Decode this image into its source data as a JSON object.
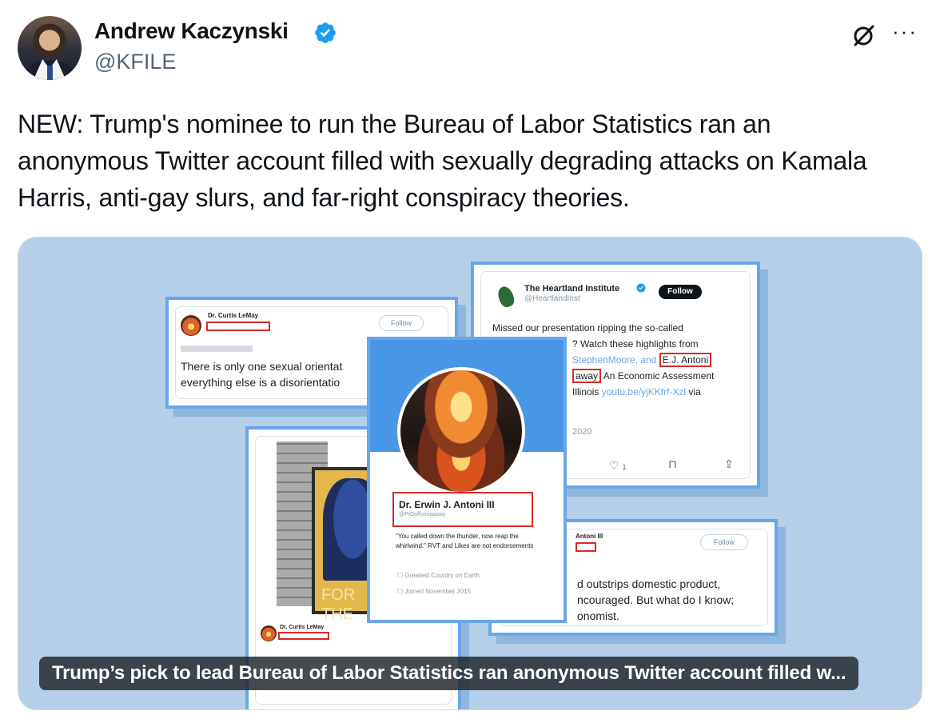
{
  "author": {
    "name": "Andrew Kaczynski",
    "handle": "@KFILE",
    "verified_color": "#1d9bf0"
  },
  "icons": {
    "grok": "grok-icon",
    "more": "more-icon",
    "verified": "verified-badge-icon"
  },
  "tweet": {
    "text": "NEW: Trump's nominee to run the Bureau of Labor Statistics ran an anonymous Twitter account filled with sexually degrading attacks on Kamala Harris, anti-gay slurs, and far-right conspiracy theories."
  },
  "media": {
    "caption": "Trump’s pick to lead Bureau of Labor Statistics ran anonymous Twitter account filled w...",
    "background": "#b5cfe8",
    "card_left": {
      "name": "Dr. Curtis LeMay",
      "follow": "Follow",
      "text_line1": "There is only one sexual orientat",
      "text_line2": "everything else is a disorientatio"
    },
    "card_heartland": {
      "name": "The Heartland Institute",
      "handle": "@HeartlandInst",
      "follow": "Follow",
      "line1": "Missed our presentation ripping the so-called",
      "line2": "? Watch these highlights from",
      "line3": "StephenMoore, and",
      "line3_boxed": "E.J. Antoni",
      "line4_boxed": "away",
      "line4": "An Economic Assessment",
      "line5": "Illinois",
      "line5_link": "youtu.be/yjKKfrf-Xzl",
      "line5_end": "via",
      "year": "2020",
      "likes": "1"
    },
    "card_center": {
      "name": "Dr. Erwin J. Antoni III",
      "handle": "@PrDoffomlaaway",
      "bio": "\"You called down the thunder, now reap the whirlwind.\" RVT and Likes are not endorsements",
      "location": "Greatest Country on Earth",
      "joined": "Joined November 2015"
    },
    "card_right_bottom": {
      "name": "Antoni III",
      "follow": "Follow",
      "line1": "d outstrips domestic product,",
      "line2": "ncouraged. But what do I know;",
      "line3": "onomist."
    },
    "card_bottom_left": {
      "poster_text": "FOR THE",
      "reply_name": "Dr. Curtis LeMay"
    }
  }
}
